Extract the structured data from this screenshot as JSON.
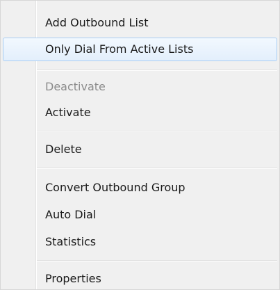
{
  "context_menu": {
    "items": [
      {
        "label": "Add Outbound List"
      },
      {
        "label": "Only Dial From Active Lists"
      },
      {
        "label": "Deactivate"
      },
      {
        "label": "Activate"
      },
      {
        "label": "Delete"
      },
      {
        "label": "Convert Outbound Group"
      },
      {
        "label": "Auto Dial"
      },
      {
        "label": "Statistics"
      },
      {
        "label": "Properties"
      }
    ],
    "highlighted_item": "Only Dial From Active Lists",
    "disabled_items": [
      "Deactivate"
    ],
    "colors": {
      "background": "#f0f0f0",
      "highlight_border": "#a8cdf3",
      "disabled_text": "#8c8c8c"
    }
  }
}
